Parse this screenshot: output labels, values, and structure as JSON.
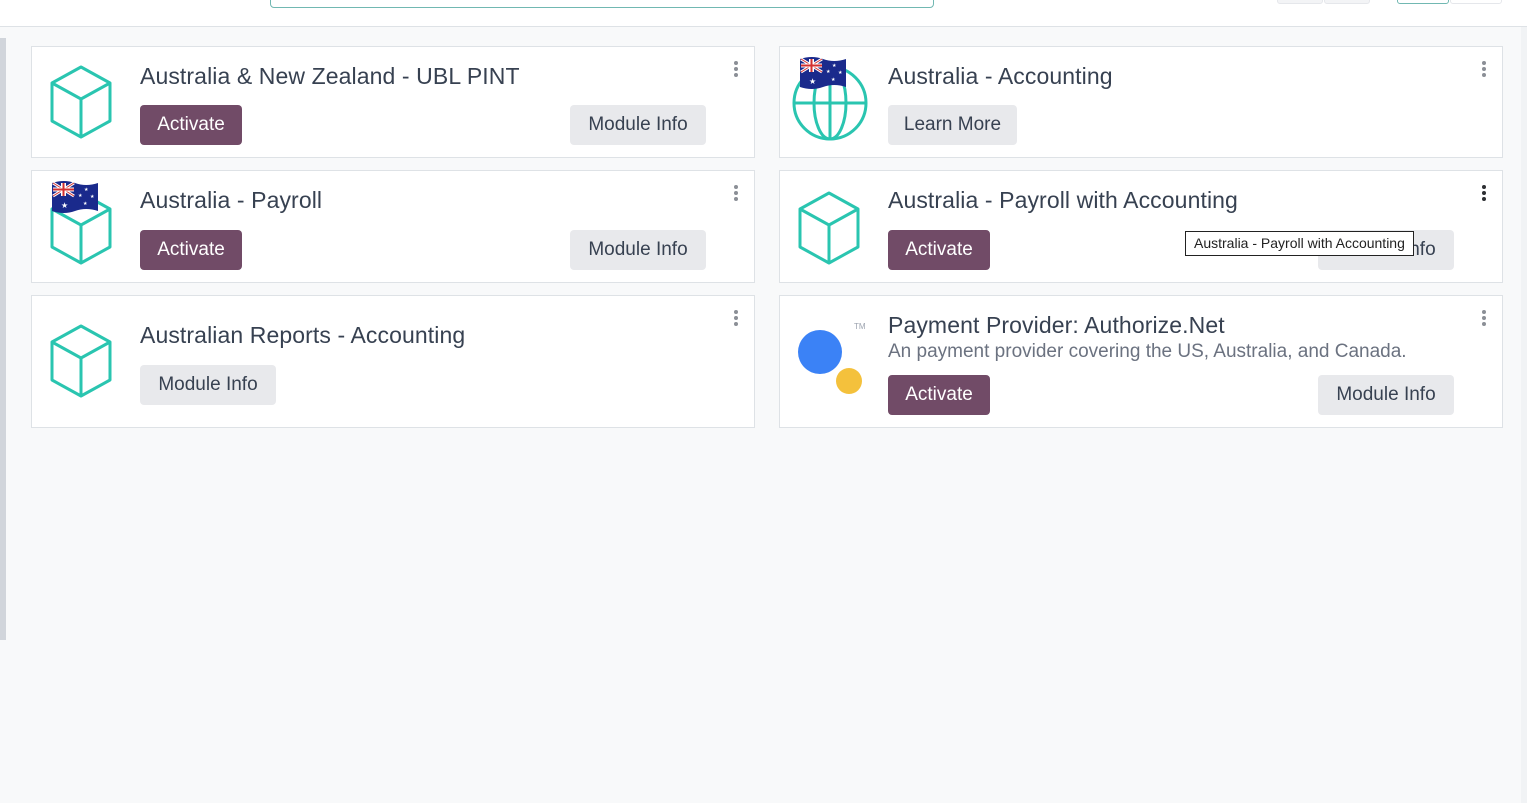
{
  "colors": {
    "accent": "#714b67",
    "icon_teal": "#2ac5b0",
    "secondary_btn": "#e8e9ec",
    "provider_blue": "#3b82f6",
    "provider_yellow": "#f4c13c"
  },
  "modules": [
    {
      "title": "Australia & New Zealand - UBL PINT",
      "icon": "cube-icon",
      "primary_label": "Activate",
      "secondary_label": "Module Info"
    },
    {
      "title": "Australia - Accounting",
      "icon": "globe-flag-icon",
      "secondary_label": "Learn More"
    },
    {
      "title": "Australia - Payroll",
      "icon": "cube-flag-icon",
      "primary_label": "Activate",
      "secondary_label": "Module Info"
    },
    {
      "title": "Australia - Payroll with Accounting",
      "icon": "cube-icon",
      "primary_label": "Activate",
      "secondary_label": "Module Info"
    },
    {
      "title": "Australian Reports - Accounting",
      "icon": "cube-icon",
      "secondary_label": "Module Info"
    },
    {
      "title": "Payment Provider: Authorize.Net",
      "summary": "An payment provider covering the US, Australia, and Canada.",
      "icon": "authorize-net-icon",
      "tm": "TM",
      "primary_label": "Activate",
      "secondary_label": "Module Info"
    }
  ],
  "tooltip": {
    "text": "Australia - Payroll with Accounting"
  }
}
